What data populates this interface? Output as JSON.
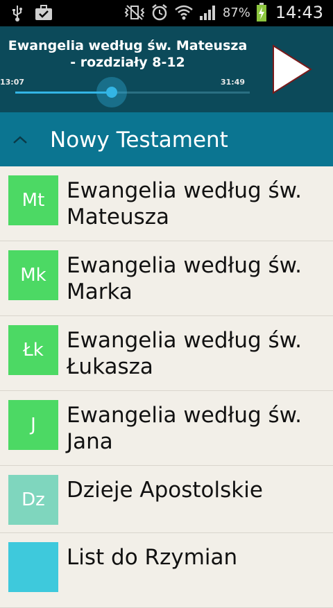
{
  "status_bar": {
    "battery_pct": "87%",
    "time": "14:43",
    "icons": [
      "usb-icon",
      "briefcase-icon",
      "vibrate-mute-icon",
      "alarm-icon",
      "wifi-icon",
      "signal-icon",
      "battery-charging-icon"
    ]
  },
  "player": {
    "track_title": "Ewangelia według św. Mateusza - rozdziały 8-12",
    "elapsed": "13:07",
    "duration": "31:49",
    "progress": 0.41,
    "play_icon": "play-icon"
  },
  "section": {
    "title": "Nowy Testament",
    "toggle_icon": "chevron-up-icon"
  },
  "books": [
    {
      "abbr": "Mt",
      "name": "Ewangelia według św. Mateusza",
      "color": "#4cd964"
    },
    {
      "abbr": "Mk",
      "name": "Ewangelia według św. Marka",
      "color": "#4cd964"
    },
    {
      "abbr": "Łk",
      "name": "Ewangelia według św. Łukasza",
      "color": "#4cd964"
    },
    {
      "abbr": "J",
      "name": "Ewangelia według św. Jana",
      "color": "#4cd964"
    },
    {
      "abbr": "Dz",
      "name": "Dzieje Apostolskie",
      "color": "#7fd6be"
    },
    {
      "abbr": "",
      "name": "List do Rzymian",
      "color": "#3ec9dc"
    }
  ]
}
